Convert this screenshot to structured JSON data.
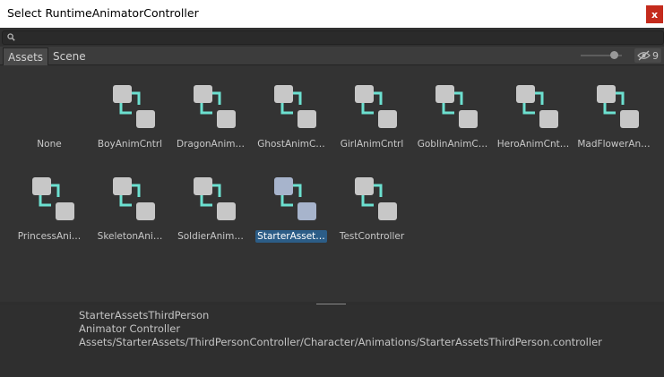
{
  "window": {
    "title": "Select RuntimeAnimatorController",
    "close_label": "x"
  },
  "search": {
    "value": "",
    "placeholder": ""
  },
  "tabs": [
    {
      "label": "Assets",
      "active": true
    },
    {
      "label": "Scene",
      "active": false
    }
  ],
  "toolbar": {
    "hidden_count": "9",
    "zoom_level": 0.75
  },
  "colors": {
    "accent": "#2c5d87",
    "icon_link": "#6ce0d0",
    "icon_node": "#c7c7c7",
    "icon_node_selected": "#a7b4cc"
  },
  "items": [
    {
      "label": "None",
      "icon": "none"
    },
    {
      "label": "BoyAnimCntrl",
      "icon": "animator-controller-icon"
    },
    {
      "label": "DragonAnim…",
      "icon": "animator-controller-icon"
    },
    {
      "label": "GhostAnimC…",
      "icon": "animator-controller-icon"
    },
    {
      "label": "GirlAnimCntrl",
      "icon": "animator-controller-icon"
    },
    {
      "label": "GoblinAnimC…",
      "icon": "animator-controller-icon"
    },
    {
      "label": "HeroAnimCnt…",
      "icon": "animator-controller-icon"
    },
    {
      "label": "MadFlowerAn…",
      "icon": "animator-controller-icon"
    },
    {
      "label": "PrincessAni…",
      "icon": "animator-controller-icon"
    },
    {
      "label": "SkeletonAni…",
      "icon": "animator-controller-icon"
    },
    {
      "label": "SoldierAnim…",
      "icon": "animator-controller-icon"
    },
    {
      "label": "StarterAsset…",
      "icon": "animator-controller-icon",
      "selected": true
    },
    {
      "label": "TestController",
      "icon": "animator-controller-icon"
    }
  ],
  "details": {
    "name": "StarterAssetsThirdPerson",
    "type": "Animator Controller",
    "path": "Assets/StarterAssets/ThirdPersonController/Character/Animations/StarterAssetsThirdPerson.controller"
  }
}
